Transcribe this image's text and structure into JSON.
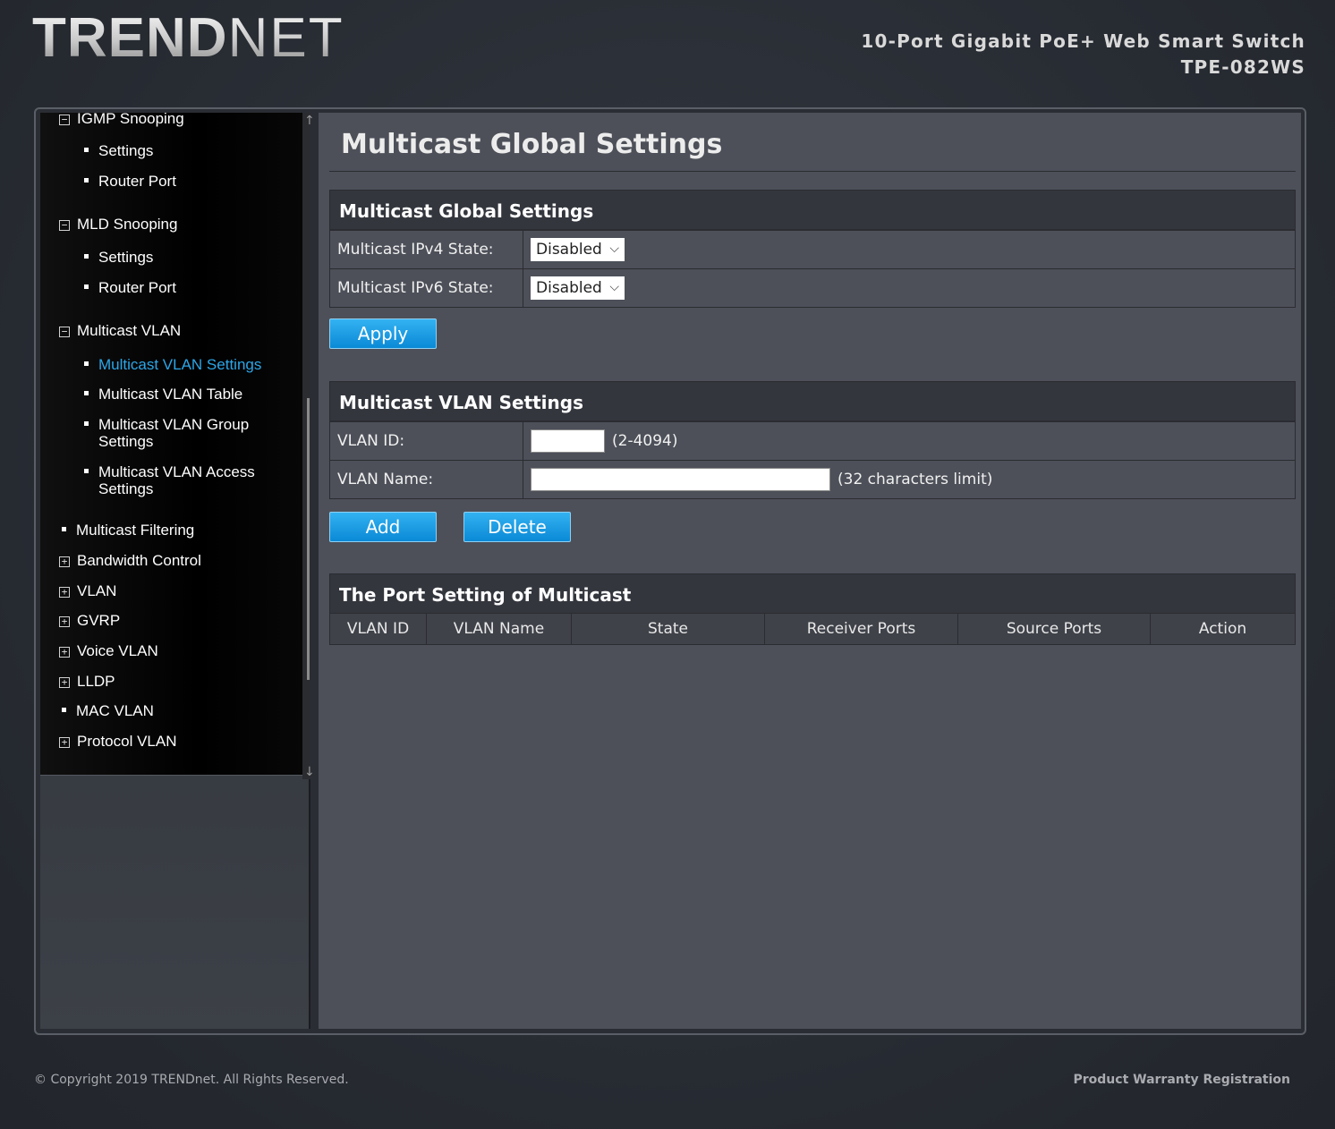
{
  "brand": {
    "logo_main": "TREND",
    "logo_rest": "net",
    "product_name": "10-Port Gigabit PoE+ Web Smart Switch",
    "model": "TPE-082WS"
  },
  "sidebar": {
    "items": [
      {
        "label": "IGMP Snooping",
        "type": "group-expanded",
        "icon": "collapse-box-icon"
      },
      {
        "label": "Settings",
        "type": "sub"
      },
      {
        "label": "Router Port",
        "type": "sub"
      },
      {
        "label": "MLD Snooping",
        "type": "group-expanded",
        "icon": "collapse-box-icon"
      },
      {
        "label": "Settings",
        "type": "sub"
      },
      {
        "label": "Router Port",
        "type": "sub"
      },
      {
        "label": "Multicast VLAN",
        "type": "group-expanded",
        "icon": "collapse-box-icon"
      },
      {
        "label": "Multicast VLAN Settings",
        "type": "sub",
        "active": true
      },
      {
        "label": "Multicast VLAN Table",
        "type": "sub"
      },
      {
        "label": "Multicast VLAN Group Settings",
        "type": "sub"
      },
      {
        "label": "Multicast VLAN Access Settings",
        "type": "sub"
      },
      {
        "label": "Multicast Filtering",
        "type": "leaf"
      },
      {
        "label": "Bandwidth Control",
        "type": "group-collapsed",
        "icon": "expand-box-icon"
      },
      {
        "label": "VLAN",
        "type": "group-collapsed",
        "icon": "expand-box-icon"
      },
      {
        "label": "GVRP",
        "type": "group-collapsed",
        "icon": "expand-box-icon"
      },
      {
        "label": "Voice VLAN",
        "type": "group-collapsed",
        "icon": "expand-box-icon"
      },
      {
        "label": "LLDP",
        "type": "group-collapsed",
        "icon": "expand-box-icon"
      },
      {
        "label": "MAC VLAN",
        "type": "leaf"
      },
      {
        "label": "Protocol VLAN",
        "type": "group-collapsed",
        "icon": "expand-box-icon"
      }
    ],
    "minus_glyph": "−",
    "plus_glyph": "+"
  },
  "main": {
    "page_title": "Multicast Global Settings",
    "global_panel": {
      "title": "Multicast Global Settings",
      "ipv4_label": "Multicast IPv4 State:",
      "ipv4_value": "Disabled",
      "ipv6_label": "Multicast IPv6 State:",
      "ipv6_value": "Disabled",
      "apply_label": "Apply"
    },
    "vlan_panel": {
      "title": "Multicast VLAN Settings",
      "vlan_id_label": "VLAN ID:",
      "vlan_id_value": "",
      "vlan_id_hint": "(2-4094)",
      "vlan_name_label": "VLAN Name:",
      "vlan_name_value": "",
      "vlan_name_hint": "(32 characters limit)",
      "add_label": "Add",
      "delete_label": "Delete"
    },
    "port_panel": {
      "title": "The Port Setting of Multicast",
      "columns": [
        "VLAN ID",
        "VLAN Name",
        "State",
        "Receiver Ports",
        "Source Ports",
        "Action"
      ]
    }
  },
  "footer": {
    "copyright": "© Copyright 2019 TRENDnet. All Rights Reserved.",
    "warranty": "Product Warranty Registration"
  },
  "colors": {
    "accent_blue": "#2ca6e8",
    "button_blue": "#0a89d6",
    "panel_bg": "#4d5059",
    "header_bg": "#33363d"
  },
  "icons": {
    "select_chevron": "⌵",
    "scroll_up": "↑",
    "scroll_down": "↓"
  }
}
